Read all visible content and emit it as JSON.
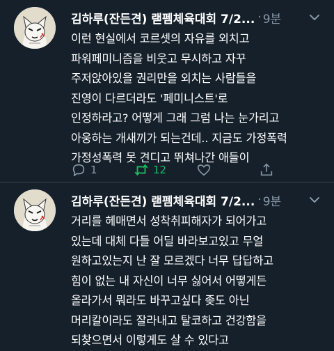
{
  "tweets": [
    {
      "name": "김하루(잔든견) 랟펨체육대회 7/2...",
      "sep": "·",
      "time": "9분",
      "lines": [
        "이런 현실에서 코르셋의 자유를 외치고",
        "파워페미니즘을 비웃고 무시하고 자꾸",
        "주저앉아있을 권리만을 외치는 사람들을",
        "진영이 다르더라도 '페미니스트'로",
        "인정하라고? 어떻게 그래 그럼 나는 눈가리고",
        "아웅하는 개새끼가 되는건데.. 지금도 가정폭력",
        "가정성폭력 못 견디고 뛰쳐나간 애들이"
      ],
      "actions": {
        "reply": "1",
        "retweet": "12",
        "like": "",
        "share": ""
      }
    },
    {
      "name": "김하루(잔든견) 랟펨체육대회 7/2...",
      "sep": "·",
      "time": "9분",
      "lines": [
        "거리를 헤매면서 성착취피해자가 되어가고",
        "있는데 대체 다들 어딜 바라보고있고 무얼",
        "원하고있는지 난 잘 모르겠다 너무 답답하고",
        "힘이 없는 내 자신이 너무 싫어서 어떻게든",
        "올라가서 뭐라도 바꾸고싶다 좆도 아닌",
        "머리칼이라도 잘라내고 탈코하고 건강함을",
        "되찾으면서 이렇게도 살 수 있다고"
      ]
    }
  ],
  "colors": {
    "background": "#15202b",
    "muted": "#8899a6",
    "retweet": "#17bf63"
  }
}
